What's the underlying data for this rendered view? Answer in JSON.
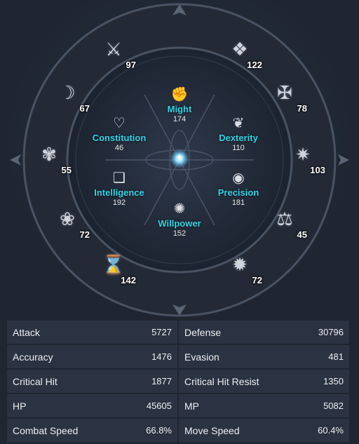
{
  "wheel": {
    "center_glyph": "✦",
    "stats": [
      {
        "key": "might",
        "name": "Might",
        "value": "174",
        "icon": "fist-icon",
        "glyph": "✊"
      },
      {
        "key": "constitution",
        "name": "Constitution",
        "value": "46",
        "icon": "heart-icon",
        "glyph": "♡"
      },
      {
        "key": "dexterity",
        "name": "Dexterity",
        "value": "110",
        "icon": "wing-icon",
        "glyph": "❦"
      },
      {
        "key": "intelligence",
        "name": "Intelligence",
        "value": "192",
        "icon": "book-icon",
        "glyph": "❑"
      },
      {
        "key": "precision",
        "name": "Precision",
        "value": "181",
        "icon": "eye-icon",
        "glyph": "◉"
      },
      {
        "key": "willpower",
        "name": "Willpower",
        "value": "152",
        "icon": "orbit-icon",
        "glyph": "✺"
      }
    ],
    "sigils": [
      {
        "value": "97",
        "icon": "sword-shield-icon",
        "glyph": "⚔"
      },
      {
        "value": "122",
        "icon": "claw-icon",
        "glyph": "❖"
      },
      {
        "value": "67",
        "icon": "bird-icon",
        "glyph": "☽"
      },
      {
        "value": "78",
        "icon": "crossed-blades-icon",
        "glyph": "✠"
      },
      {
        "value": "55",
        "icon": "butterfly-icon",
        "glyph": "✾"
      },
      {
        "value": "103",
        "icon": "star-icon",
        "glyph": "✷"
      },
      {
        "value": "72",
        "icon": "tree-icon",
        "glyph": "❀"
      },
      {
        "value": "45",
        "icon": "scales-icon",
        "glyph": "⚖"
      },
      {
        "value": "142",
        "icon": "hourglass-icon",
        "glyph": "⌛"
      },
      {
        "value": "72",
        "icon": "sun-burst-icon",
        "glyph": "✹"
      }
    ]
  },
  "attributes": [
    {
      "left_label": "Attack",
      "left_value": "5727",
      "right_label": "Defense",
      "right_value": "30796"
    },
    {
      "left_label": "Accuracy",
      "left_value": "1476",
      "right_label": "Evasion",
      "right_value": "481"
    },
    {
      "left_label": "Critical Hit",
      "left_value": "1877",
      "right_label": "Critical Hit Resist",
      "right_value": "1350"
    },
    {
      "left_label": "HP",
      "left_value": "45605",
      "right_label": "MP",
      "right_value": "5082"
    },
    {
      "left_label": "Combat Speed",
      "left_value": "66.8%",
      "right_label": "Move Speed",
      "right_value": "60.4%"
    }
  ],
  "colors": {
    "stat_name": "#2fd6e6",
    "panel": "#2b3241",
    "background": "#1f2632"
  }
}
